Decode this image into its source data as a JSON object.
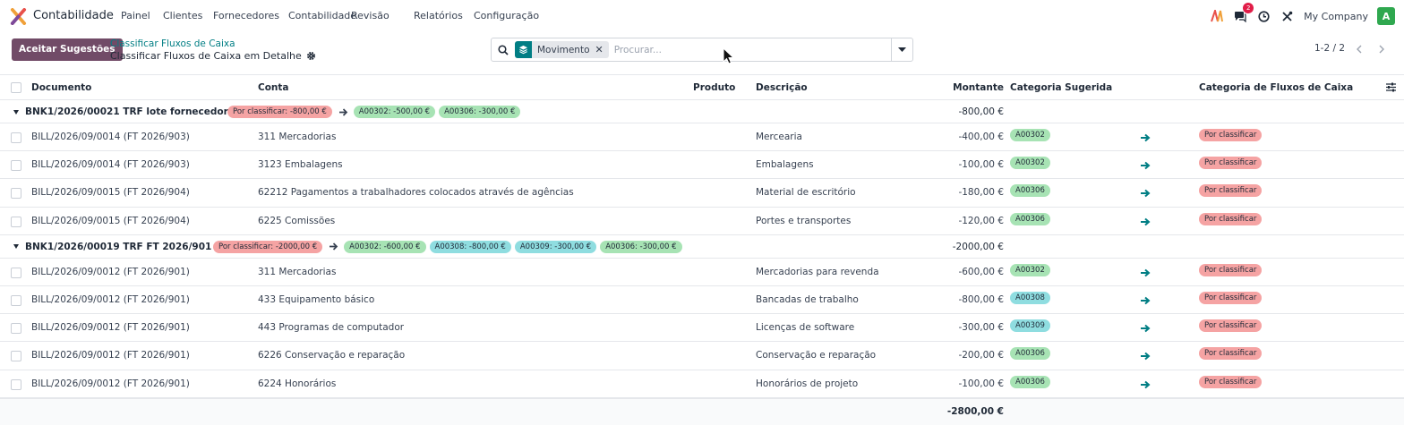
{
  "app": {
    "name": "Contabilidade",
    "menu": [
      "Painel",
      "Clientes",
      "Fornecedores",
      "Contabilidade",
      "Revisão",
      "Relatórios",
      "Configuração"
    ],
    "chat_badge": "2",
    "company": "My Company",
    "avatar_letter": "A",
    "brand_color": "#714b67",
    "accent_color": "#017e84"
  },
  "control": {
    "primary_button": "Aceitar Sugestões",
    "breadcrumb": "Classificar Fluxos de Caixa",
    "title": "Classificar Fluxos de Caixa em Detalhe",
    "search": {
      "facet_label": "Movimento",
      "placeholder": "Procurar..."
    },
    "pager": "1-2 / 2"
  },
  "table": {
    "columns": {
      "documento": "Documento",
      "conta": "Conta",
      "produto": "Produto",
      "descricao": "Descrição",
      "montante": "Montante",
      "categoria_sugerida": "Categoria Sugerida",
      "categoria_fluxos": "Categoria de Fluxos de Caixa"
    },
    "groups": [
      {
        "title": "BNK1/2026/00021 TRF lote fornecedor (4)",
        "pending": "Por classificar: -800,00 €",
        "suggestions": [
          {
            "label": "A00302: -500,00 €",
            "color": "green"
          },
          {
            "label": "A00306: -300,00 €",
            "color": "green"
          }
        ],
        "total": "-800,00 €",
        "rows": [
          {
            "documento": "BILL/2026/09/0014 (FT 2026/903)",
            "conta": "311 Mercadorias",
            "descricao": "Mercearia",
            "montante": "-400,00 €",
            "sugerida": "A00302",
            "sugerida_color": "green",
            "categoria": "Por classificar"
          },
          {
            "documento": "BILL/2026/09/0014 (FT 2026/903)",
            "conta": "3123 Embalagens",
            "descricao": "Embalagens",
            "montante": "-100,00 €",
            "sugerida": "A00302",
            "sugerida_color": "green",
            "categoria": "Por classificar"
          },
          {
            "documento": "BILL/2026/09/0015 (FT 2026/904)",
            "conta": "62212 Pagamentos a trabalhadores colocados através de agências",
            "descricao": "Material de escritório",
            "montante": "-180,00 €",
            "sugerida": "A00306",
            "sugerida_color": "green",
            "categoria": "Por classificar"
          },
          {
            "documento": "BILL/2026/09/0015 (FT 2026/904)",
            "conta": "6225 Comissões",
            "descricao": "Portes e transportes",
            "montante": "-120,00 €",
            "sugerida": "A00306",
            "sugerida_color": "green",
            "categoria": "Por classificar"
          }
        ]
      },
      {
        "title": "BNK1/2026/00019 TRF FT 2026/901 (5)",
        "pending": "Por classificar: -2000,00 €",
        "suggestions": [
          {
            "label": "A00302: -600,00 €",
            "color": "green"
          },
          {
            "label": "A00308: -800,00 €",
            "color": "teal"
          },
          {
            "label": "A00309: -300,00 €",
            "color": "teal"
          },
          {
            "label": "A00306: -300,00 €",
            "color": "green"
          }
        ],
        "total": "-2000,00 €",
        "rows": [
          {
            "documento": "BILL/2026/09/0012 (FT 2026/901)",
            "conta": "311 Mercadorias",
            "descricao": "Mercadorias para revenda",
            "montante": "-600,00 €",
            "sugerida": "A00302",
            "sugerida_color": "green",
            "categoria": "Por classificar"
          },
          {
            "documento": "BILL/2026/09/0012 (FT 2026/901)",
            "conta": "433 Equipamento básico",
            "descricao": "Bancadas de trabalho",
            "montante": "-800,00 €",
            "sugerida": "A00308",
            "sugerida_color": "teal",
            "categoria": "Por classificar"
          },
          {
            "documento": "BILL/2026/09/0012 (FT 2026/901)",
            "conta": "443 Programas de computador",
            "descricao": "Licenças de software",
            "montante": "-300,00 €",
            "sugerida": "A00309",
            "sugerida_color": "teal",
            "categoria": "Por classificar"
          },
          {
            "documento": "BILL/2026/09/0012 (FT 2026/901)",
            "conta": "6226 Conservação e reparação",
            "descricao": "Conservação e reparação",
            "montante": "-200,00 €",
            "sugerida": "A00306",
            "sugerida_color": "green",
            "categoria": "Por classificar"
          },
          {
            "documento": "BILL/2026/09/0012 (FT 2026/901)",
            "conta": "6224 Honorários",
            "descricao": "Honorários de projeto",
            "montante": "-100,00 €",
            "sugerida": "A00306",
            "sugerida_color": "green",
            "categoria": "Por classificar"
          }
        ]
      }
    ],
    "grand_total": "-2800,00 €"
  }
}
